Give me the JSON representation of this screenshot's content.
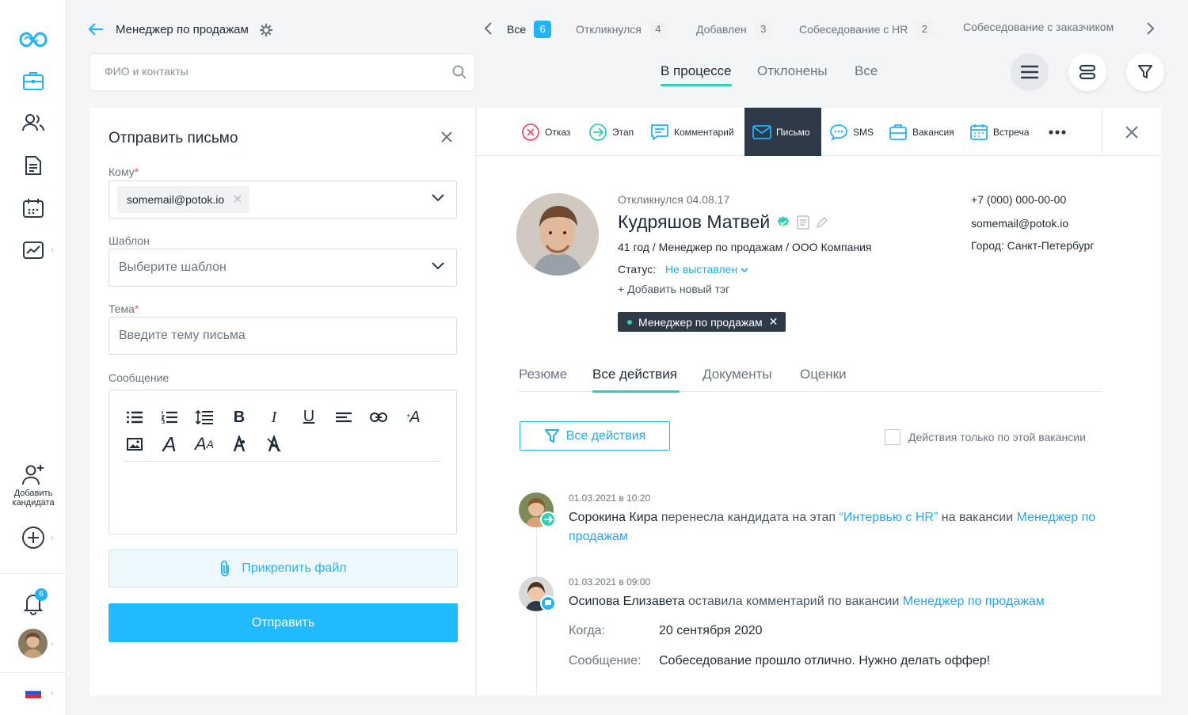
{
  "header": {
    "title": "Менеджер по продажам",
    "stages": [
      {
        "label": "Все",
        "count": "6"
      },
      {
        "label": "Откликнулся",
        "count": "4"
      },
      {
        "label": "Добавлен",
        "count": "3"
      },
      {
        "label": "Собеседование с HR",
        "count": "2"
      },
      {
        "label": "Собеседование с заказчиком"
      }
    ]
  },
  "search": {
    "placeholder": "ФИО и контакты"
  },
  "status_tabs": [
    "В процессе",
    "Отклонены",
    "Все"
  ],
  "left_nav": {
    "add_candidate": "Добавить кандидата",
    "notifications_count": "6"
  },
  "email_form": {
    "title": "Отправить письмо",
    "to_label": "Кому",
    "to_value": "somemail@potok.io",
    "template_label": "Шаблон",
    "template_placeholder": "Выберите шаблон",
    "subject_label": "Тема",
    "subject_placeholder": "Введите тему письма",
    "message_label": "Сообщение",
    "attach_label": "Прикрепить файл",
    "send_label": "Отправить"
  },
  "actions_bar": [
    {
      "label": "Отказ",
      "icon": "reject-icon"
    },
    {
      "label": "Этап",
      "icon": "stage-arrow-icon"
    },
    {
      "label": "Комментарий",
      "icon": "comment-icon"
    },
    {
      "label": "Письмо",
      "icon": "mail-icon"
    },
    {
      "label": "SMS",
      "icon": "sms-icon"
    },
    {
      "label": "Вакансия",
      "icon": "briefcase-icon"
    },
    {
      "label": "Встреча",
      "icon": "calendar-icon"
    }
  ],
  "candidate": {
    "responded": "Откликнулся 04.08.17",
    "name": "Кудряшов Матвей",
    "summary": "41 год / Менеджер по продажам / ООО Компания",
    "status_label": "Статус:",
    "status_value": "Не выставлен",
    "add_tag": "+ Добавить новый тэг",
    "tag": "Менеджер по продажам",
    "phone": "+7 (000) 000-00-00",
    "email": "somemail@potok.io",
    "city": "Город: Санкт-Петербург"
  },
  "detail_tabs": [
    "Резюме",
    "Все действия",
    "Документы",
    "Оценки"
  ],
  "filter": {
    "button": "Все действия",
    "checkbox_label": "Действия только по этой вакансии"
  },
  "events": [
    {
      "date": "01.03.2021 в 10:20",
      "author": "Сорокина Кира",
      "text1": " перенесла кандидата на этап ",
      "stage": "“Интервью с HR”",
      "text2": " на вакансии ",
      "vacancy": "Менеджер по продажам"
    },
    {
      "date": "01.03.2021 в 09:00",
      "author": "Осипова Елизавета",
      "text1": " оставила комментарий по вакансии ",
      "vacancy": "Менеджер по продажам",
      "when_label": "Когда:",
      "when_value": "20 сентября 2020",
      "message_label": "Сообщение:",
      "message_value": "Собеседование прошло отлично. Нужно делать оффер!"
    }
  ],
  "colors": {
    "accent": "#21b3ff",
    "accent_green": "#2fd0b3",
    "dark": "#2e3a47",
    "required": "#f54d6d",
    "reject_red": "#f54d6d"
  }
}
